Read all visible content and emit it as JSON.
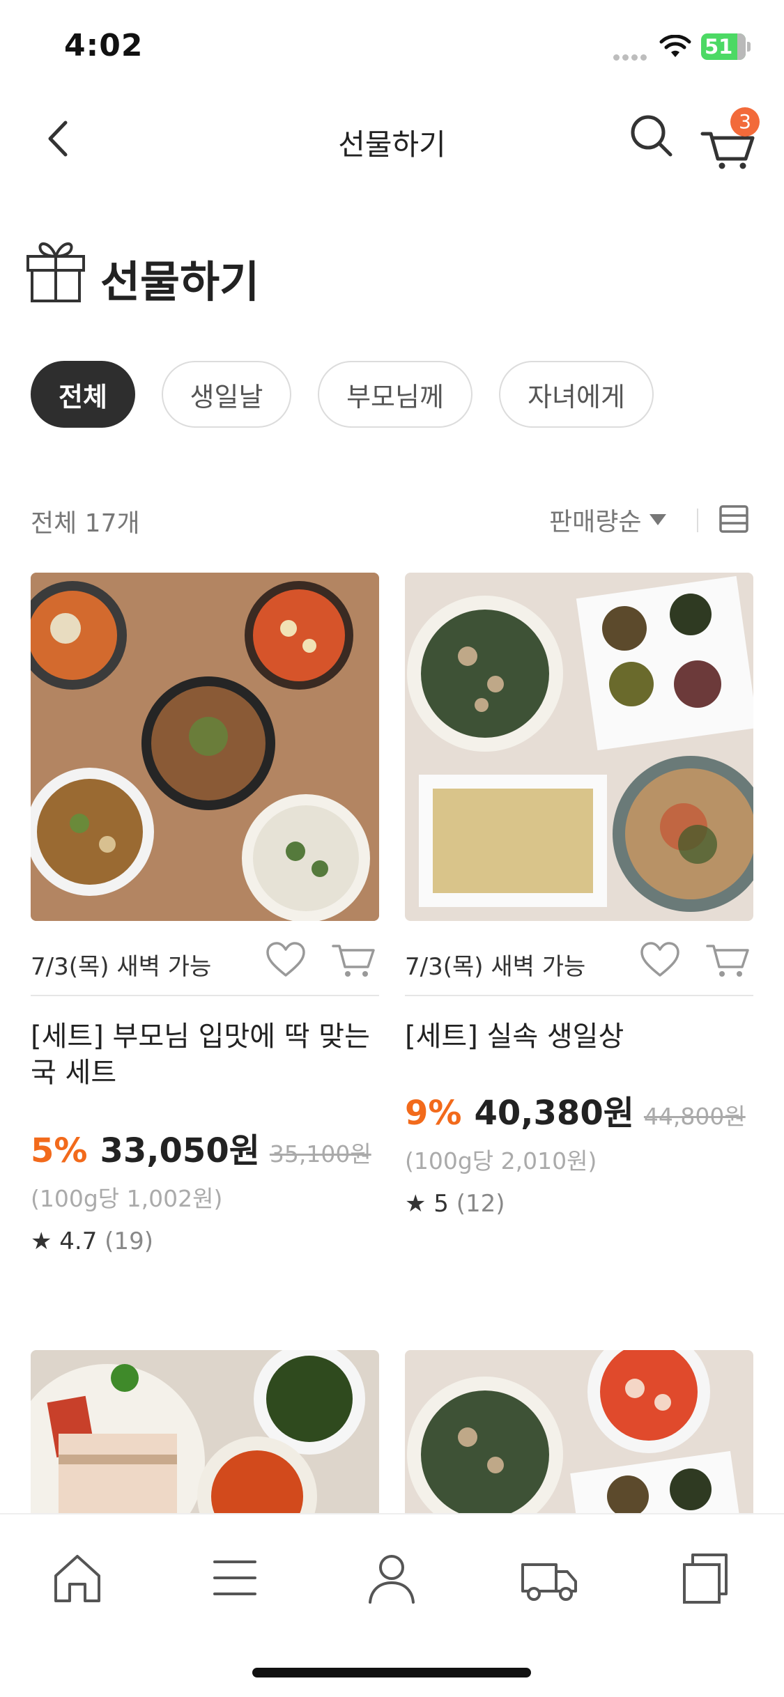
{
  "status_bar": {
    "time": "4:02",
    "battery": "51"
  },
  "nav": {
    "title": "선물하기",
    "cart_badge": "3"
  },
  "heading": {
    "title": "선물하기"
  },
  "filters": [
    {
      "label": "전체",
      "active": true
    },
    {
      "label": "생일날",
      "active": false
    },
    {
      "label": "부모님께",
      "active": false
    },
    {
      "label": "자녀에게",
      "active": false
    }
  ],
  "list": {
    "count_label": "전체 17개",
    "sort_label": "판매량순"
  },
  "products": [
    {
      "delivery": "7/3(목) 새벽 가능",
      "name": "[세트] 부모님 입맛에 딱 맞는 국 세트",
      "discount": "5%",
      "price": "33,050원",
      "original_price": "35,100원",
      "unit_price": "(100g당 1,002원)",
      "rating": "★ 4.7",
      "review_count": "(19)"
    },
    {
      "delivery": "7/3(목) 새벽 가능",
      "name": "[세트] 실속 생일상",
      "discount": "9%",
      "price": "40,380원",
      "original_price": "44,800원",
      "unit_price": "(100g당 2,010원)",
      "rating": "★ 5",
      "review_count": "(12)"
    }
  ],
  "icons": {
    "back": "chevron-left-icon",
    "search": "search-icon",
    "cart": "cart-icon",
    "heading": "gift-icon",
    "heart": "heart-icon",
    "add_to_cart": "cart-add-icon",
    "view_toggle": "list-view-icon",
    "tabs": [
      "home-icon",
      "menu-icon",
      "user-icon",
      "truck-icon",
      "copy-icon"
    ]
  },
  "colors": {
    "accent": "#f26a1b",
    "badge": "#f26a3a",
    "chip_active": "#2e2e2e",
    "battery": "#4cd964"
  }
}
